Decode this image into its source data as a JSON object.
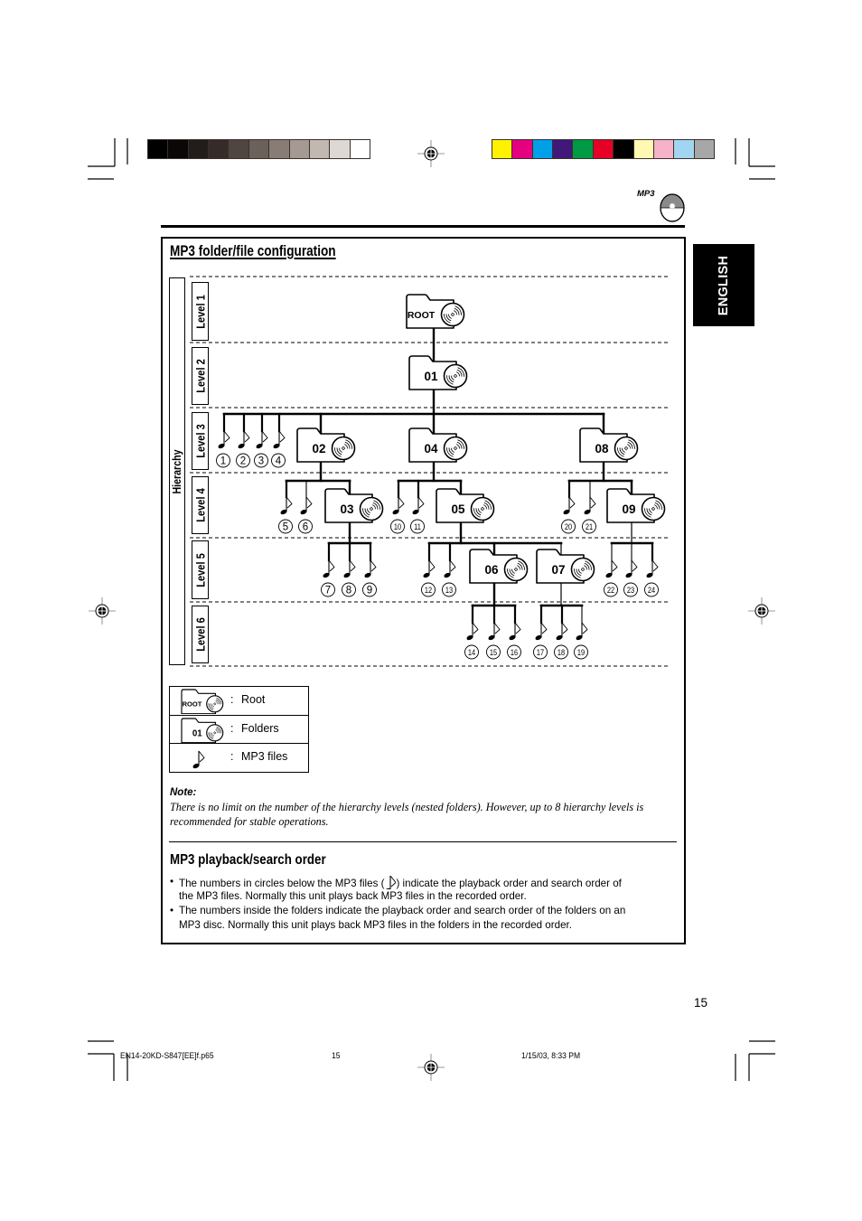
{
  "header": {
    "logo_text": "MP3",
    "language_tab": "ENGLISH"
  },
  "registration": {
    "grayscale": [
      "#000000",
      "#0b0706",
      "#221c1a",
      "#352b28",
      "#4f4641",
      "#6b615b",
      "#877c76",
      "#a59993",
      "#c2b8b2",
      "#ddd8d4",
      "#ffffff"
    ],
    "colors": [
      "#fff200",
      "#e4007f",
      "#00a0e9",
      "#40187a",
      "#009944",
      "#e60026",
      "#000000",
      "#fff9b1",
      "#f5b2c8",
      "#a2d5f2",
      "#a7a7a7"
    ]
  },
  "section1": {
    "title": "MP3 folder/file configuration",
    "hierarchy_label": "Hierarchy",
    "levels": [
      "Level 1",
      "Level 2",
      "Level 3",
      "Level 4",
      "Level 5",
      "Level 6"
    ]
  },
  "tree": {
    "folders": [
      {
        "id": "root",
        "label": "ROOT",
        "level": 1,
        "parent": null
      },
      {
        "id": "01",
        "label": "01",
        "level": 2,
        "parent": "root"
      },
      {
        "id": "02",
        "label": "02",
        "level": 3,
        "parent": "01"
      },
      {
        "id": "04",
        "label": "04",
        "level": 3,
        "parent": "01"
      },
      {
        "id": "08",
        "label": "08",
        "level": 3,
        "parent": "01"
      },
      {
        "id": "03",
        "label": "03",
        "level": 4,
        "parent": "02"
      },
      {
        "id": "05",
        "label": "05",
        "level": 4,
        "parent": "04"
      },
      {
        "id": "09",
        "label": "09",
        "level": 4,
        "parent": "08"
      },
      {
        "id": "06",
        "label": "06",
        "level": 5,
        "parent": "05"
      },
      {
        "id": "07",
        "label": "07",
        "level": 5,
        "parent": "05"
      }
    ],
    "files": [
      {
        "number": "1",
        "level": 3,
        "folder": "01"
      },
      {
        "number": "2",
        "level": 3,
        "folder": "01"
      },
      {
        "number": "3",
        "level": 3,
        "folder": "01"
      },
      {
        "number": "4",
        "level": 3,
        "folder": "01"
      },
      {
        "number": "5",
        "level": 4,
        "folder": "02"
      },
      {
        "number": "6",
        "level": 4,
        "folder": "02"
      },
      {
        "number": "7",
        "level": 5,
        "folder": "03"
      },
      {
        "number": "8",
        "level": 5,
        "folder": "03"
      },
      {
        "number": "9",
        "level": 5,
        "folder": "03"
      },
      {
        "number": "10",
        "level": 4,
        "folder": "04"
      },
      {
        "number": "11",
        "level": 4,
        "folder": "04"
      },
      {
        "number": "12",
        "level": 5,
        "folder": "05"
      },
      {
        "number": "13",
        "level": 5,
        "folder": "05"
      },
      {
        "number": "14",
        "level": 6,
        "folder": "06"
      },
      {
        "number": "15",
        "level": 6,
        "folder": "06"
      },
      {
        "number": "16",
        "level": 6,
        "folder": "06"
      },
      {
        "number": "17",
        "level": 6,
        "folder": "07"
      },
      {
        "number": "18",
        "level": 6,
        "folder": "07"
      },
      {
        "number": "19",
        "level": 6,
        "folder": "07"
      },
      {
        "number": "20",
        "level": 4,
        "folder": "08"
      },
      {
        "number": "21",
        "level": 4,
        "folder": "08"
      },
      {
        "number": "22",
        "level": 5,
        "folder": "09"
      },
      {
        "number": "23",
        "level": 5,
        "folder": "09"
      },
      {
        "number": "24",
        "level": 5,
        "folder": "09"
      }
    ]
  },
  "legend": [
    {
      "icon": "root-folder-icon",
      "icon_label": "ROOT",
      "separator": ":",
      "text": "Root"
    },
    {
      "icon": "folder-icon",
      "icon_label": "01",
      "separator": ":",
      "text": "Folders"
    },
    {
      "icon": "music-note-icon",
      "icon_label": "",
      "separator": ":",
      "text": "MP3 files"
    }
  ],
  "note": {
    "heading": "Note:",
    "lines": [
      "There is no limit on the number of the hierarchy levels (nested folders). However, up to 8 hierarchy levels is",
      "recommended for stable operations."
    ]
  },
  "section2": {
    "title": "MP3 playback/search order",
    "bullet_symbol": "•",
    "bullets": [
      {
        "line1_before_icon": "The numbers in circles below the MP3 files (",
        "line1_after_icon": ") indicate the playback order and search order of",
        "line2": "the MP3 files. Normally this unit plays back MP3 files in the recorded order."
      },
      {
        "line1": "The numbers inside the folders indicate the playback order and search order of the folders on an",
        "line2": "MP3 disc. Normally this unit plays back MP3 files in the folders in the recorded order."
      }
    ]
  },
  "page_number": "15",
  "footer": {
    "filename": "EN14-20KD-S847[EE]f.p65",
    "page": "15",
    "timestamp": "1/15/03, 8:33 PM"
  }
}
